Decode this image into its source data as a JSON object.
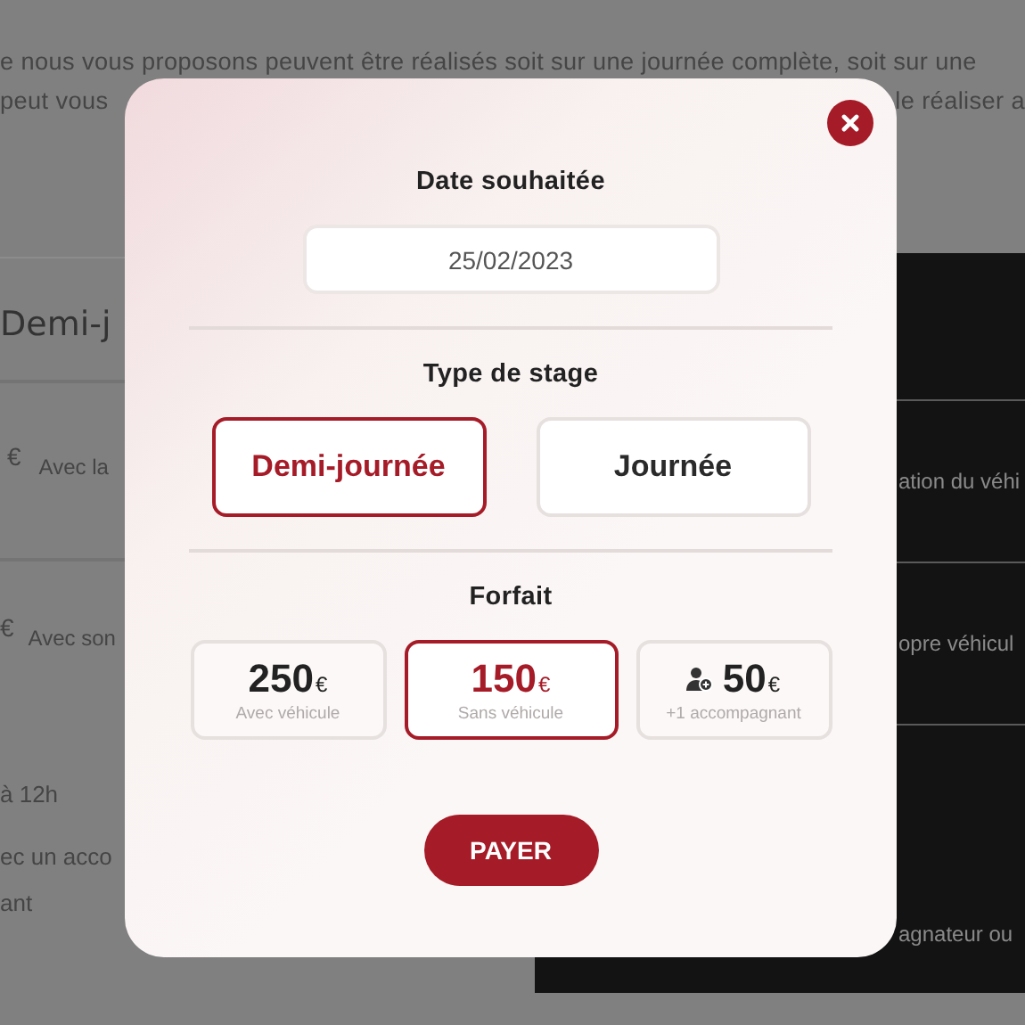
{
  "background": {
    "intro_lines": [
      {
        "left": "e nous vous proposons peuvent être réalisés soit sur une journée complète, soit sur une"
      },
      {
        "left": "peut vous",
        "right": "le réaliser a"
      }
    ],
    "left_panel": {
      "title": "Demi-j",
      "offers": [
        {
          "currency": "€",
          "text": "Avec la"
        },
        {
          "currency": "€",
          "text": "Avec son"
        }
      ],
      "details": [
        "à 12h",
        "ec un acco",
        "ant"
      ]
    },
    "right_panel": {
      "texts": [
        "ation du véhi",
        "opre véhicul",
        "agnateur ou"
      ]
    }
  },
  "modal": {
    "date_label": "Date souhaitée",
    "date_value": "25/02/2023",
    "type_label": "Type de stage",
    "types": [
      {
        "label": "Demi-journée",
        "selected": true
      },
      {
        "label": "Journée",
        "selected": false
      }
    ],
    "forfait_label": "Forfait",
    "forfaits": [
      {
        "kind": "plain",
        "price": "250",
        "currency": "€",
        "caption": "Avec véhicule",
        "selected": false
      },
      {
        "kind": "plain",
        "price": "150",
        "currency": "€",
        "caption": "Sans véhicule",
        "selected": true
      },
      {
        "kind": "companion",
        "price": "50",
        "currency": "€",
        "caption": "+1 accompagnant",
        "selected": false
      }
    ],
    "pay_button": "PAYER"
  }
}
